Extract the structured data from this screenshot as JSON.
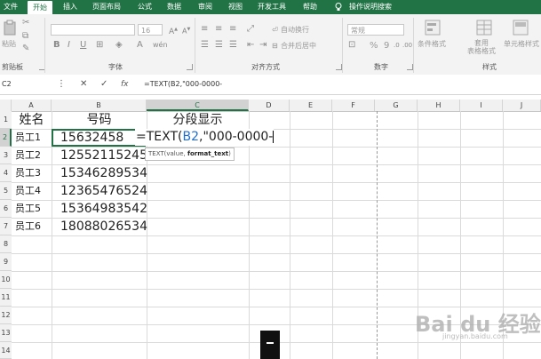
{
  "menubar": {
    "items": [
      "文件",
      "开始",
      "插入",
      "页面布局",
      "公式",
      "数据",
      "审阅",
      "视图",
      "开发工具",
      "帮助",
      "操作说明搜索"
    ]
  },
  "ribbon": {
    "paste_label": "粘贴",
    "clipboard_label": "剪贴板",
    "font_label": "字体",
    "font_size": "16",
    "align_label": "对齐方式",
    "wrap_text": "自动换行",
    "merge_center": "合并后居中",
    "number_label": "数字",
    "number_format": "常规",
    "percent_symbol": "%",
    "comma_symbol": "9",
    "styles_label": "样式",
    "conditional_format": "条件格式",
    "table_format": "套用\n表格格式",
    "cell_styles": "单元格样式"
  },
  "formula_bar": {
    "name_box": "C2",
    "cancel_icon": "✕",
    "enter_icon": "✓",
    "fx_label": "fx",
    "formula": "=TEXT(B2,\"000-0000-"
  },
  "columns": [
    "A",
    "B",
    "C",
    "D",
    "E",
    "F",
    "G",
    "H",
    "I",
    "J"
  ],
  "rows": [
    "1",
    "2",
    "3",
    "4",
    "5",
    "6",
    "7",
    "8",
    "9",
    "10",
    "11",
    "12",
    "13",
    "14"
  ],
  "sheet": {
    "header": {
      "a": "姓名",
      "b": "号码",
      "c": "分段显示"
    },
    "data": [
      {
        "a": "员工1",
        "b": "15632458"
      },
      {
        "a": "员工2",
        "b": "12552115245"
      },
      {
        "a": "员工3",
        "b": "15346289534"
      },
      {
        "a": "员工4",
        "b": "12365476524"
      },
      {
        "a": "员工5",
        "b": "15364983542"
      },
      {
        "a": "员工6",
        "b": "18088026534"
      }
    ],
    "edit_prefix": "=TEXT(",
    "edit_ref": "B2",
    "edit_suffix": ",\"000-0000-",
    "tooltip_func": "TEXT(value, ",
    "tooltip_arg": "format_text",
    "tooltip_close": ")"
  },
  "watermark": {
    "main": "Bai du 经验",
    "sub": "jingyan.baidu.com"
  },
  "colors": {
    "excel_green": "#217346",
    "ref_blue": "#1f6fd1"
  }
}
